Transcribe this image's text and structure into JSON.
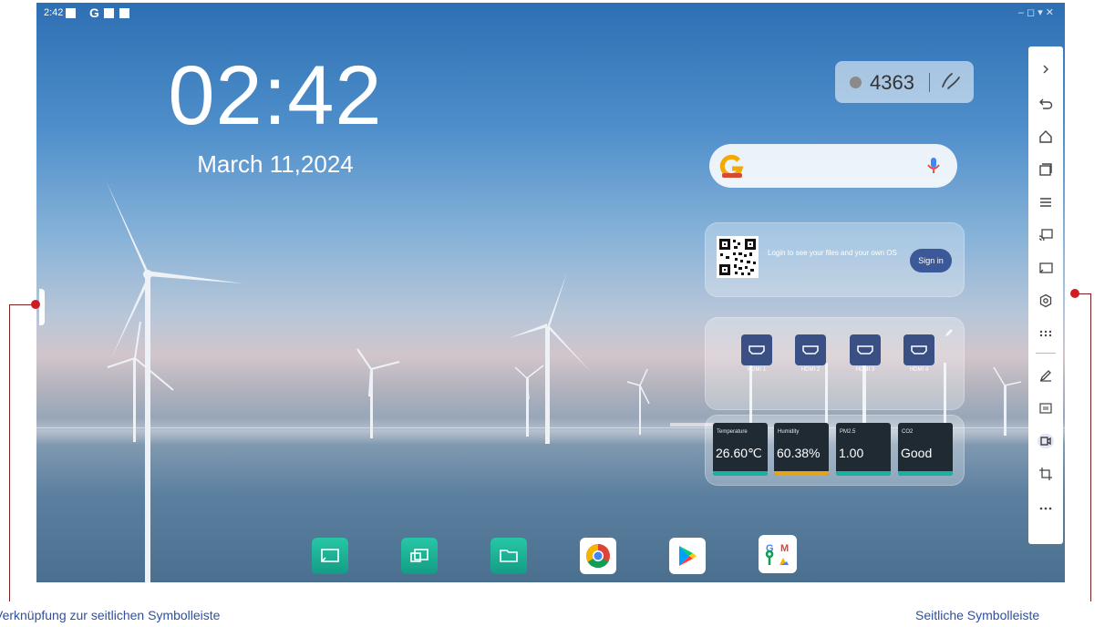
{
  "status_bar": {
    "time": "2:42",
    "g_label": "G",
    "right_icons": "– ◻ ▾ ✕"
  },
  "clock": {
    "time": "02:42",
    "date": "March 11,2024"
  },
  "code_widget": {
    "code": "4363"
  },
  "search": {
    "placeholder": ""
  },
  "login_widget": {
    "message": "Login to see your files and your own OS",
    "button": "Sign in"
  },
  "hdmi_widget": {
    "inputs": [
      "HDMI 1",
      "HDMI 2",
      "HDMI 3",
      "HDMI 4"
    ]
  },
  "sensors": [
    {
      "label": "Temperature",
      "value": "26.60℃",
      "color": "#17b3a0"
    },
    {
      "label": "Humidity",
      "value": "60.38%",
      "color": "#e3a51c"
    },
    {
      "label": "PM2.5",
      "value": "1.00",
      "color": "#17b3a0"
    },
    {
      "label": "CO2",
      "value": "Good",
      "color": "#17b3a0"
    }
  ],
  "sidebar": {
    "items": [
      "collapse-icon",
      "back-icon",
      "home-icon",
      "recent-apps-icon",
      "menu-icon",
      "screen-cast-icon",
      "source-icon",
      "settings-icon",
      "apps-grid-icon",
      "pen-icon",
      "freeze-icon",
      "camera-icon",
      "crop-icon",
      "more-icon"
    ]
  },
  "dock": {
    "apps": [
      "screen-share",
      "multi-screen",
      "file-manager",
      "chrome",
      "play-store",
      "google-apps"
    ],
    "google_grid_letters": [
      "G",
      "M"
    ]
  },
  "captions": {
    "left": "Verknüpfung zur seitlichen Symbolleiste",
    "right": "Seitliche Symbolleiste"
  },
  "colors": {
    "accent_teal": "#1bb59a",
    "signin_blue": "#3b5899",
    "callout_red": "#d11b24",
    "caption_blue": "#2f4f9f"
  }
}
